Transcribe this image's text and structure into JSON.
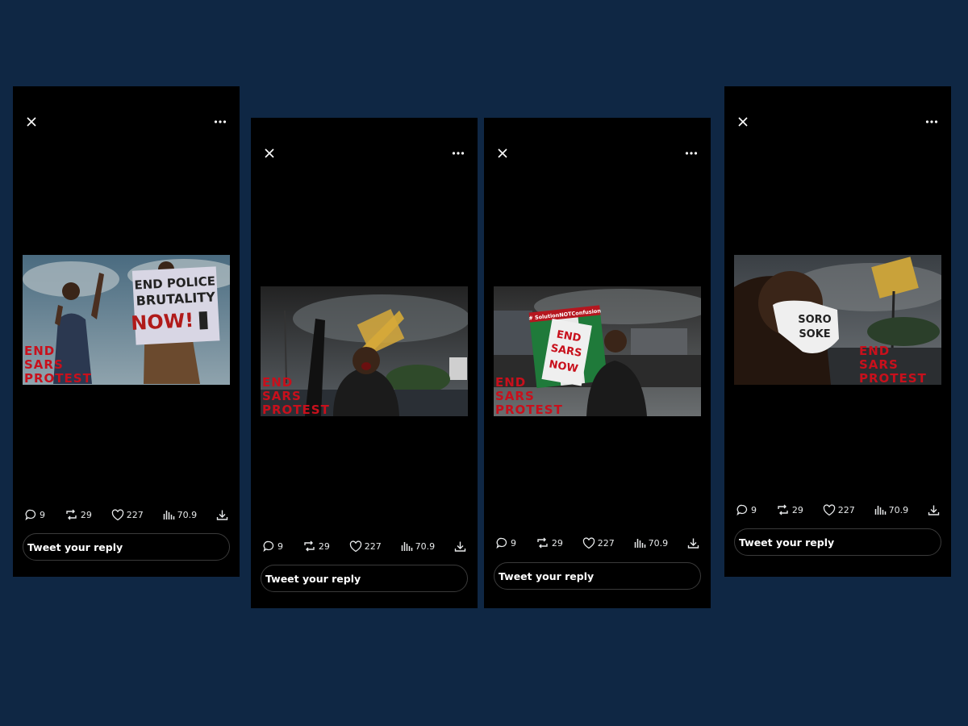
{
  "posts": [
    {
      "overlay": [
        "END",
        "SARS",
        "PROTEST"
      ],
      "sign_lines": [
        "END POLICE",
        "BRUTALITY",
        "NOW!"
      ],
      "stats": {
        "replies": "9",
        "retweets": "29",
        "likes": "227",
        "views": "70.9"
      },
      "reply_placeholder": "Tweet your reply"
    },
    {
      "overlay": [
        "END",
        "SARS",
        "PROTEST"
      ],
      "stats": {
        "replies": "9",
        "retweets": "29",
        "likes": "227",
        "views": "70.9"
      },
      "reply_placeholder": "Tweet your reply"
    },
    {
      "overlay": [
        "END",
        "SARS",
        "PROTEST"
      ],
      "sign_lines": [
        "# SolutionNOTConfusion",
        "END",
        "SARS",
        "NOW"
      ],
      "stats": {
        "replies": "9",
        "retweets": "29",
        "likes": "227",
        "views": "70.9"
      },
      "reply_placeholder": "Tweet your reply"
    },
    {
      "overlay": [
        "END",
        "SARS",
        "PROTEST"
      ],
      "sign_lines": [
        "SORO",
        "SOKE"
      ],
      "stats": {
        "replies": "9",
        "retweets": "29",
        "likes": "227",
        "views": "70.9"
      },
      "reply_placeholder": "Tweet your reply"
    }
  ],
  "icons": {
    "close": "close-icon",
    "more": "more-icon",
    "reply": "reply-icon",
    "retweet": "retweet-icon",
    "like": "heart-icon",
    "views": "views-icon",
    "download": "download-icon"
  },
  "colors": {
    "page_background": "#0f2744",
    "panel_background": "#000000",
    "overlay_text": "#c8101c"
  }
}
